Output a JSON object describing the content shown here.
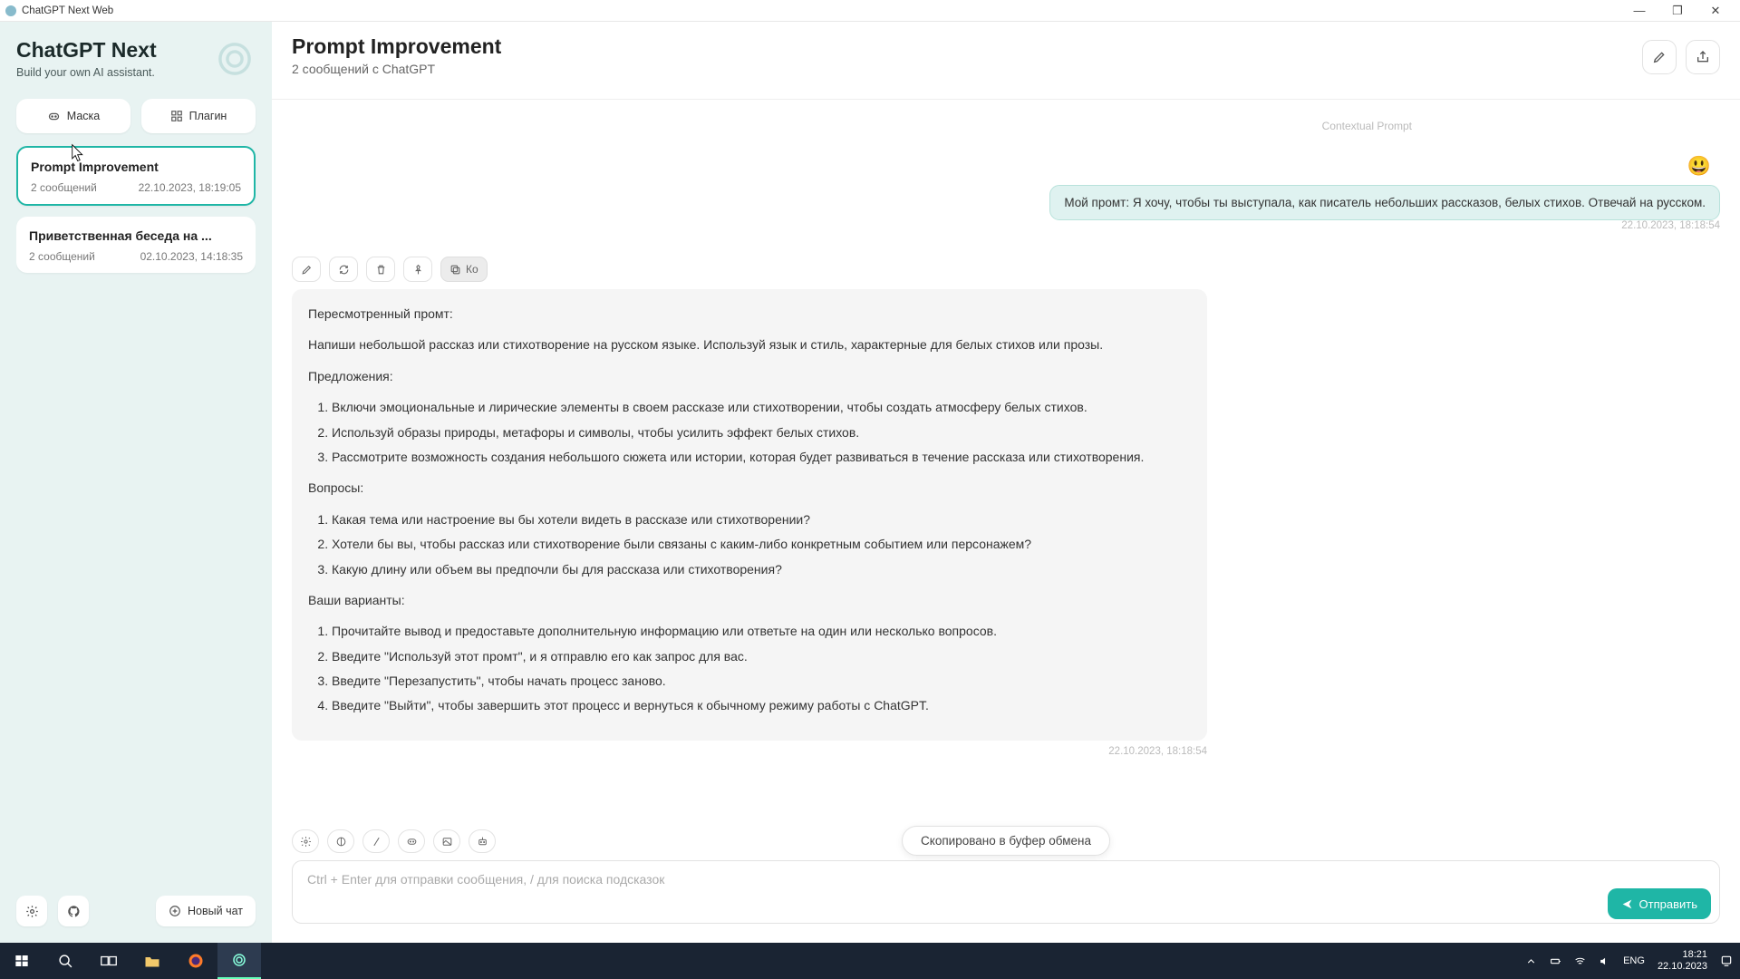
{
  "window": {
    "title": "ChatGPT Next Web"
  },
  "sidebar": {
    "brand_title": "ChatGPT Next",
    "brand_subtitle": "Build your own AI assistant.",
    "mask_label": "Маска",
    "plugin_label": "Плагин",
    "conversations": [
      {
        "title": "Prompt Improvement",
        "count": "2 сообщений",
        "time": "22.10.2023, 18:19:05",
        "active": true
      },
      {
        "title": "Приветственная беседа на ...",
        "count": "2 сообщений",
        "time": "02.10.2023, 14:18:35",
        "active": false
      }
    ],
    "newchat_label": "Новый чат"
  },
  "header": {
    "title": "Prompt Improvement",
    "subtitle": "2 сообщений с ChatGPT"
  },
  "chat": {
    "context_label": "Contextual Prompt",
    "user_emoji": "😃",
    "user_message": "Мой промт: Я хочу, чтобы ты выступала, как писатель небольших рассказов, белых стихов. Отвечай на русском.",
    "user_ts": "22.10.2023, 18:18:54",
    "copy_label": "Ко",
    "assistant": {
      "p1": "Пересмотренный промт:",
      "p2": "Напиши небольшой рассказ или стихотворение на русском языке. Используй язык и стиль, характерные для белых стихов или прозы.",
      "p3": "Предложения:",
      "s1": "Включи эмоциональные и лирические элементы в своем рассказе или стихотворении, чтобы создать атмосферу белых стихов.",
      "s2": "Используй образы природы, метафоры и символы, чтобы усилить эффект белых стихов.",
      "s3": "Рассмотрите возможность создания небольшого сюжета или истории, которая будет развиваться в течение рассказа или стихотворения.",
      "p4": "Вопросы:",
      "q1": "Какая тема или настроение вы бы хотели видеть в рассказе или стихотворении?",
      "q2": "Хотели бы вы, чтобы рассказ или стихотворение были связаны с каким-либо конкретным событием или персонажем?",
      "q3": "Какую длину или объем вы предпочли бы для рассказа или стихотворения?",
      "p5": "Ваши варианты:",
      "o1": "Прочитайте вывод и предоставьте дополнительную информацию или ответьте на один или несколько вопросов.",
      "o2": "Введите \"Используй этот промт\", и я отправлю его как запрос для вас.",
      "o3": "Введите \"Перезапустить\", чтобы начать процесс заново.",
      "o4": "Введите \"Выйти\", чтобы завершить этот процесс и вернуться к обычному режиму работы с ChatGPT."
    },
    "assistant_ts": "22.10.2023, 18:18:54"
  },
  "composer": {
    "placeholder": "Ctrl + Enter для отправки сообщения, / для поиска подсказок",
    "send_label": "Отправить"
  },
  "toast": {
    "text": "Скопировано в буфер обмена"
  },
  "taskbar": {
    "lang": "ENG",
    "time": "18:21",
    "date": "22.10.2023"
  }
}
